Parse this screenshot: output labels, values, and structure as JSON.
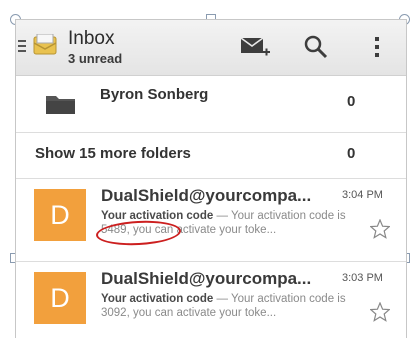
{
  "actionbar": {
    "title": "Inbox",
    "subtitle": "3 unread",
    "icons": [
      "menu-drawer-icon",
      "inbox-envelope-icon",
      "compose-mail-icon",
      "search-icon",
      "overflow-menu-icon"
    ]
  },
  "folders": [
    {
      "name": "Byron Sonberg",
      "count": "0",
      "icon": "folder-icon"
    }
  ],
  "more_folders": {
    "label": "Show 15 more folders",
    "count": "0"
  },
  "messages": [
    {
      "avatar": "D",
      "sender": "DualShield@yourcompa...",
      "time": "3:04 PM",
      "subject": "Your activation code",
      "separator": " — ",
      "preview": "Your activation code is 5489, you can activate your toke...",
      "star": "☆"
    },
    {
      "avatar": "D",
      "sender": "DualShield@yourcompa...",
      "time": "3:03 PM",
      "subject": "Your activation code",
      "separator": " — ",
      "preview": "Your activation code is 3092, you can activate your toke...",
      "star": "☆"
    }
  ],
  "colors": {
    "avatar_bg": "#f2a03d",
    "annotation": "#cc1f1f",
    "actionbar_bg": "#ececec"
  }
}
